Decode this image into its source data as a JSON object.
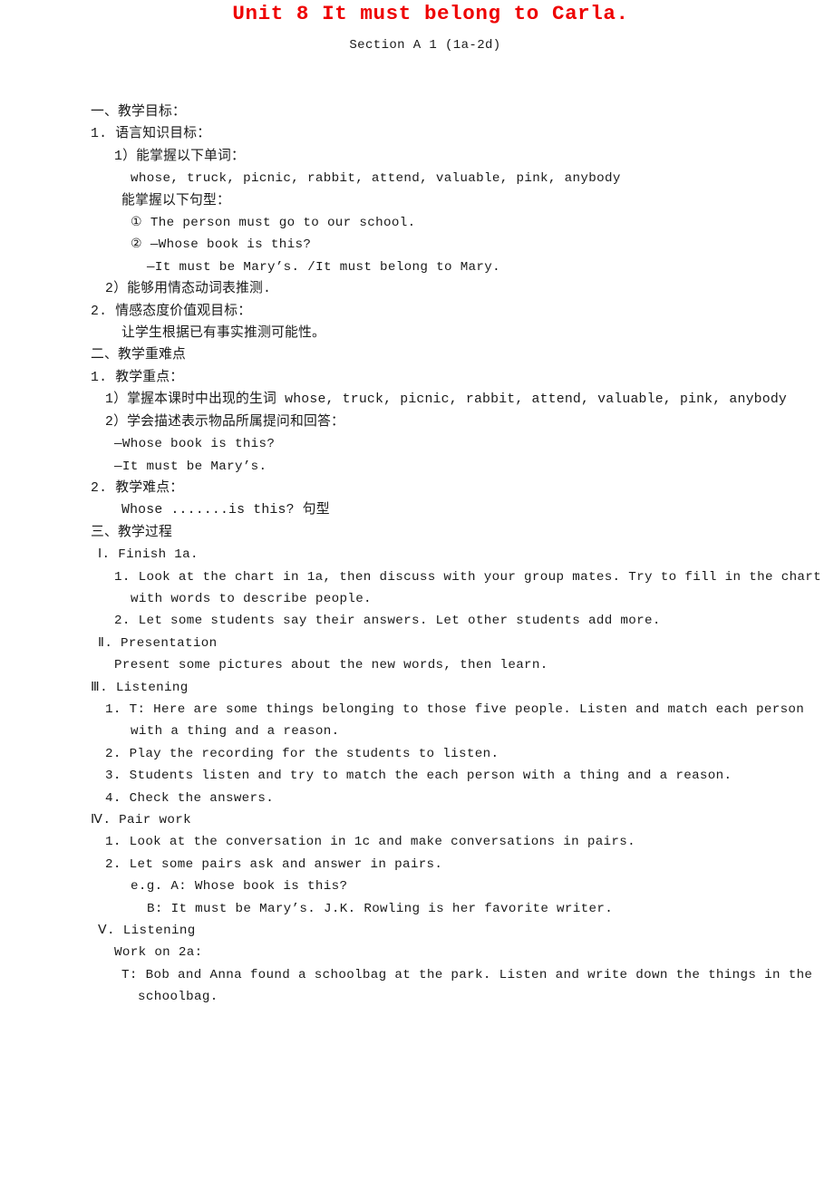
{
  "document": {
    "title": "Unit 8 It must belong to Carla.",
    "subtitle": "Section A 1 (1a-2d)",
    "title_color": "#ee0000",
    "body_color": "#1a1a1a"
  },
  "lines": [
    {
      "id": "l01",
      "text": "一、教学目标：",
      "indent": 0,
      "script": "cn"
    },
    {
      "id": "l02",
      "text": "1. 语言知识目标：",
      "indent": 0,
      "script": "cn"
    },
    {
      "id": "l03",
      "text": "1）能掌握以下单词：",
      "indent": 3,
      "script": "cn"
    },
    {
      "id": "l04",
      "text": "whose, truck, picnic, rabbit, attend, valuable, pink, anybody",
      "indent": 5,
      "script": "en"
    },
    {
      "id": "l05",
      "text": "能掌握以下句型：",
      "indent": 4,
      "script": "cn"
    },
    {
      "id": "l06",
      "text": "① The person must go to our school.",
      "indent": 5,
      "script": "en"
    },
    {
      "id": "l07",
      "text": "② —Whose book is this?",
      "indent": 5,
      "script": "en"
    },
    {
      "id": "l08",
      "text": "—It must be Mary’s. /It must belong to Mary.",
      "indent": 7,
      "script": "en"
    },
    {
      "id": "l09",
      "text": "2）能够用情态动词表推测.",
      "indent": 2,
      "script": "cn"
    },
    {
      "id": "l10",
      "text": "2. 情感态度价值观目标：",
      "indent": 0,
      "script": "cn"
    },
    {
      "id": "l11",
      "text": "让学生根据已有事实推测可能性。",
      "indent": 4,
      "script": "cn"
    },
    {
      "id": "l12",
      "text": "二、教学重难点",
      "indent": 0,
      "script": "cn"
    },
    {
      "id": "l13",
      "text": "1. 教学重点：",
      "indent": 0,
      "script": "cn"
    },
    {
      "id": "l14",
      "text": "1）掌握本课时中出现的生词 whose, truck, picnic, rabbit, attend, valuable, pink, anybody",
      "indent": 2,
      "script": "cn"
    },
    {
      "id": "l15",
      "text": "2）学会描述表示物品所属提问和回答：",
      "indent": 2,
      "script": "cn"
    },
    {
      "id": "l16",
      "text": "—Whose book is this?",
      "indent": 3,
      "script": "en"
    },
    {
      "id": "l17",
      "text": "—It must be Mary’s.",
      "indent": 3,
      "script": "en"
    },
    {
      "id": "l18",
      "text": "2. 教学难点：",
      "indent": 0,
      "script": "cn"
    },
    {
      "id": "l19",
      "text": "Whose .......is this? 句型",
      "indent": 4,
      "script": "cn"
    },
    {
      "id": "l20",
      "text": "三、教学过程",
      "indent": 0,
      "script": "cn"
    },
    {
      "id": "l21",
      "text": "Ⅰ. Finish 1a.",
      "indent": 1,
      "script": "en"
    },
    {
      "id": "l22",
      "text": "1. Look at the chart in 1a, then discuss with your group mates. Try to fill in the chart",
      "indent": 3,
      "script": "en"
    },
    {
      "id": "l23",
      "text": "with words to describe people.",
      "indent": 5,
      "script": "en"
    },
    {
      "id": "l24",
      "text": "2. Let some students say their answers. Let other students add more.",
      "indent": 3,
      "script": "en"
    },
    {
      "id": "l25",
      "text": "Ⅱ. Presentation",
      "indent": 1,
      "script": "en"
    },
    {
      "id": "l26",
      "text": "Present some pictures about the new words, then learn.",
      "indent": 3,
      "script": "en"
    },
    {
      "id": "l27",
      "text": "Ⅲ. Listening",
      "indent": 0,
      "script": "en"
    },
    {
      "id": "l28",
      "text": "1. T: Here are some things belonging to those five people. Listen and match each person",
      "indent": 2,
      "script": "en"
    },
    {
      "id": "l29",
      "text": "with a thing and a reason.",
      "indent": 5,
      "script": "en"
    },
    {
      "id": "l30",
      "text": "2. Play the recording for the students to listen.",
      "indent": 2,
      "script": "en"
    },
    {
      "id": "l31",
      "text": "3. Students listen and try to match the each person with a thing and a reason.",
      "indent": 2,
      "script": "en"
    },
    {
      "id": "l32",
      "text": "4. Check the answers.",
      "indent": 2,
      "script": "en"
    },
    {
      "id": "l33",
      "text": "Ⅳ. Pair work",
      "indent": 0,
      "script": "en"
    },
    {
      "id": "l34",
      "text": "1. Look at the conversation in 1c and make conversations in pairs.",
      "indent": 2,
      "script": "en"
    },
    {
      "id": "l35",
      "text": "2. Let some pairs ask and answer in pairs.",
      "indent": 2,
      "script": "en"
    },
    {
      "id": "l36",
      "text": "e.g. A: Whose book is this?",
      "indent": 5,
      "script": "en"
    },
    {
      "id": "l37",
      "text": "B: It must be Mary’s. J.K. Rowling is her favorite writer.",
      "indent": 7,
      "script": "en"
    },
    {
      "id": "l38",
      "text": "Ⅴ. Listening",
      "indent": 1,
      "script": "en"
    },
    {
      "id": "l39",
      "text": "Work on 2a:",
      "indent": 3,
      "script": "en"
    },
    {
      "id": "l40",
      "text": "T: Bob and Anna found a schoolbag at the park. Listen and write down the things in the",
      "indent": 4,
      "script": "en"
    },
    {
      "id": "l41",
      "text": "schoolbag.",
      "indent": 6,
      "script": "en"
    }
  ]
}
